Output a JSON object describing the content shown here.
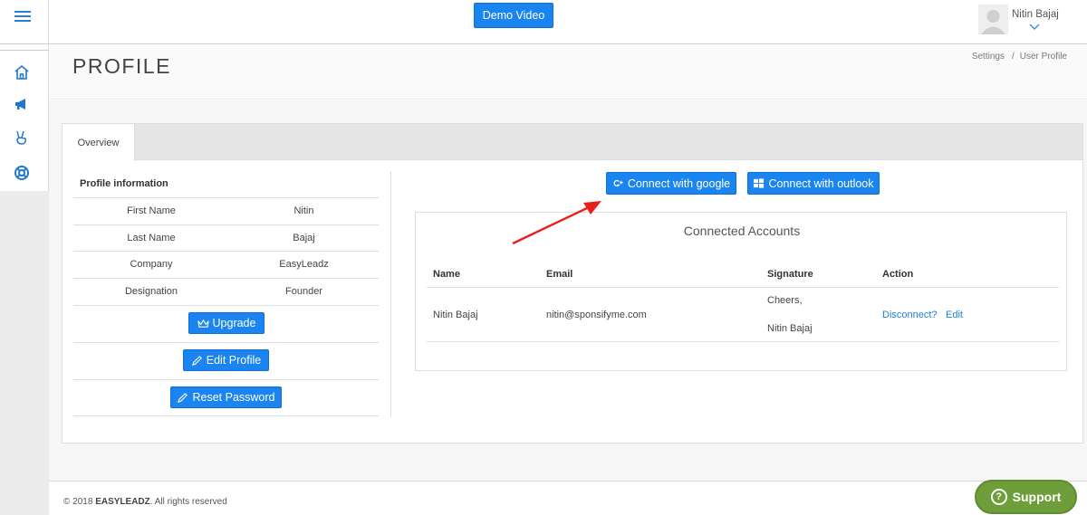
{
  "header": {
    "demo_button": "Demo Video",
    "user_name": "Nitin Bajaj"
  },
  "sidebar": {
    "items": [
      {
        "icon": "home-icon"
      },
      {
        "icon": "megaphone-icon"
      },
      {
        "icon": "peace-hand-icon"
      },
      {
        "icon": "lifebuoy-icon"
      }
    ]
  },
  "page": {
    "title": "PROFILE",
    "breadcrumb": [
      "Settings",
      "User Profile"
    ],
    "breadcrumb_sep": "/"
  },
  "tabs": [
    {
      "label": "Overview",
      "active": true
    }
  ],
  "profile": {
    "heading": "Profile information",
    "rows": [
      {
        "label": "First Name",
        "value": "Nitin"
      },
      {
        "label": "Last Name",
        "value": "Bajaj"
      },
      {
        "label": "Company",
        "value": "EasyLeadz"
      },
      {
        "label": "Designation",
        "value": "Founder"
      }
    ],
    "upgrade_label": "Upgrade",
    "edit_label": "Edit Profile",
    "reset_label": "Reset Password"
  },
  "connect": {
    "google_label": "Connect with google",
    "outlook_label": "Connect with outlook"
  },
  "accounts": {
    "title": "Connected Accounts",
    "columns": [
      "Name",
      "Email",
      "Signature",
      "Action"
    ],
    "rows": [
      {
        "name": "Nitin Bajaj",
        "email": "nitin@sponsifyme.com",
        "signature": [
          "Cheers,",
          "Nitin Bajaj"
        ],
        "actions": [
          "Disconnect?",
          "Edit"
        ]
      }
    ]
  },
  "footer": {
    "copyright": "© 2018",
    "brand": "EASYLEADZ",
    "rights": ". All rights reserved"
  },
  "support": {
    "label": "Support"
  },
  "colors": {
    "primary": "#1a84f0",
    "support": "#6e9e3a",
    "annotation_arrow": "#e8201c"
  }
}
